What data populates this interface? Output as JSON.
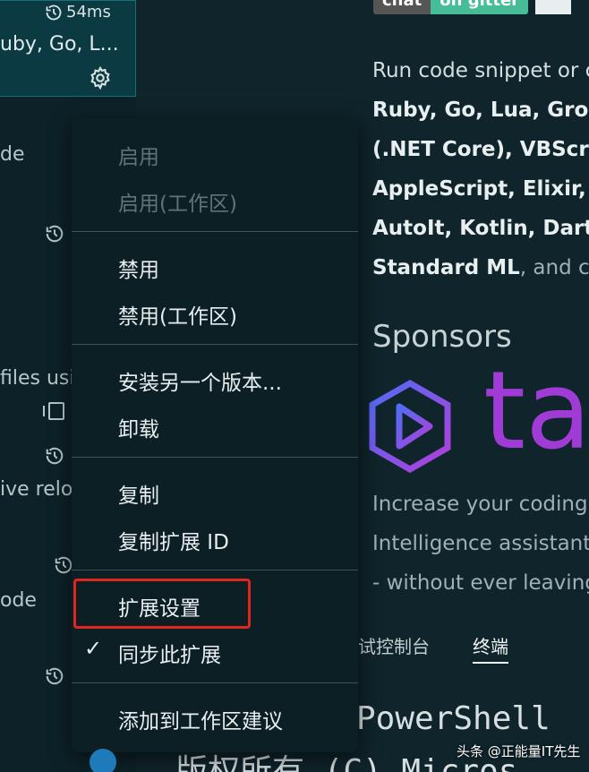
{
  "extension": {
    "activation_time": "54ms",
    "languages": "uby, Go, L..."
  },
  "left_fragments": [
    "de",
    "files usi",
    "ive relo",
    "ode"
  ],
  "readme": {
    "badge_chat": "chat",
    "badge_gitter": "on gitter",
    "lines": [
      {
        "bold": "",
        "text": "Run code snippet or c"
      },
      {
        "bold": "Ruby, Go, Lua, Groo",
        "text": ""
      },
      {
        "bold": "(.NET Core), VBScrip",
        "text": ""
      },
      {
        "bold": "AppleScript, Elixir, V",
        "text": ""
      },
      {
        "bold": "AutoIt, Kotlin, Dart, ",
        "text": ""
      },
      {
        "bold": "Standard ML",
        "text": ", and cu"
      }
    ],
    "sponsors_heading": "Sponsors",
    "brand_text": "ta",
    "sponsor_lines": [
      "Increase your coding",
      "Intelligence assistant",
      "- without ever leaving"
    ]
  },
  "panel": {
    "tabs": [
      "试控制台",
      "终端"
    ],
    "active_tab": "终端",
    "terminal_line1": "PowerShell",
    "terminal_line2": "版权所有 (C) Micros"
  },
  "context_menu": {
    "items": [
      {
        "label": "启用",
        "disabled": true
      },
      {
        "label": "启用(工作区)",
        "disabled": true
      },
      {
        "label": "禁用",
        "disabled": false
      },
      {
        "label": "禁用(工作区)",
        "disabled": false
      },
      {
        "label": "安装另一个版本...",
        "disabled": false
      },
      {
        "label": "卸载",
        "disabled": false
      },
      {
        "label": "复制",
        "disabled": false
      },
      {
        "label": "复制扩展 ID",
        "disabled": false
      },
      {
        "label": "扩展设置",
        "disabled": false,
        "highlighted": true
      },
      {
        "label": "同步此扩展",
        "disabled": false,
        "checked": true
      },
      {
        "label": "添加到工作区建议",
        "disabled": false
      }
    ],
    "check_mark": "✓"
  },
  "watermark": "头条 @正能量IT先生",
  "colors": {
    "background": "#0f242b",
    "menu_bg": "#0b1f25",
    "highlight_border": "#e0261e",
    "brand_purple": "#a03bd6",
    "gitter_green": "#46bc99"
  }
}
